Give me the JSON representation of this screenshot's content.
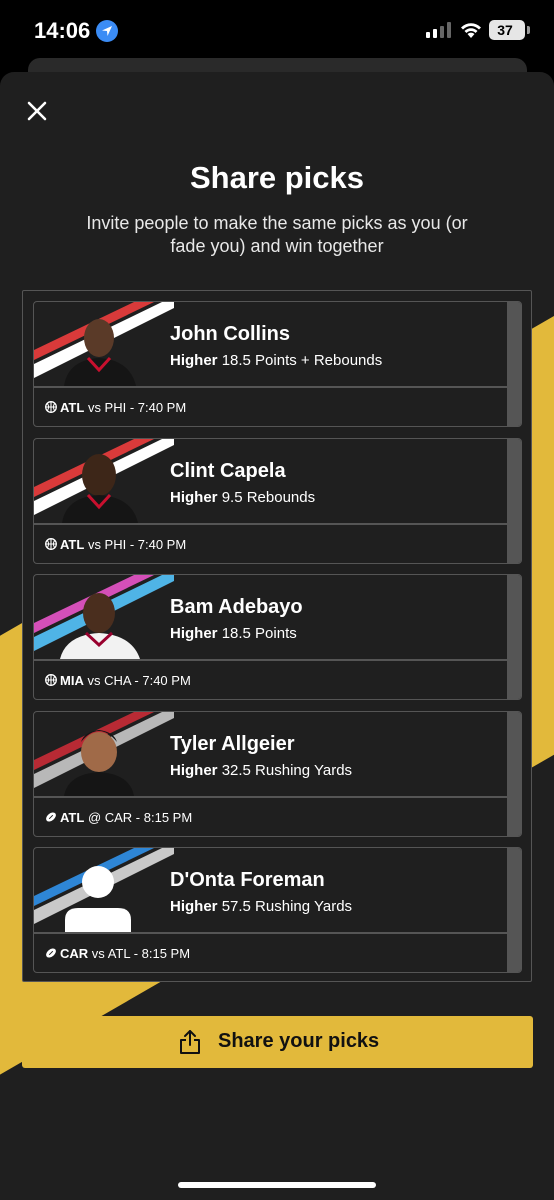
{
  "status_bar": {
    "time": "14:06",
    "battery": "37"
  },
  "sheet": {
    "title": "Share picks",
    "subtitle": "Invite people to make the same picks as you (or fade you) and win together"
  },
  "picks": [
    {
      "name": "John Collins",
      "direction": "Higher",
      "line": "18.5 Points + Rebounds",
      "team": "ATL",
      "matchup": "vs PHI - 7:40 PM",
      "sport_icon": "basketball-icon",
      "colors": [
        "#d93a3a",
        "#ffffff"
      ]
    },
    {
      "name": "Clint Capela",
      "direction": "Higher",
      "line": "9.5 Rebounds",
      "team": "ATL",
      "matchup": "vs PHI - 7:40 PM",
      "sport_icon": "basketball-icon",
      "colors": [
        "#d93a3a",
        "#ffffff"
      ]
    },
    {
      "name": "Bam Adebayo",
      "direction": "Higher",
      "line": "18.5 Points",
      "team": "MIA",
      "matchup": "vs CHA - 7:40 PM",
      "sport_icon": "basketball-icon",
      "colors": [
        "#d44fb8",
        "#4fb4e6"
      ]
    },
    {
      "name": "Tyler Allgeier",
      "direction": "Higher",
      "line": "32.5 Rushing Yards",
      "team": "ATL",
      "matchup": "@ CAR - 8:15 PM",
      "sport_icon": "football-icon",
      "colors": [
        "#b82a34",
        "#b8b8b8"
      ]
    },
    {
      "name": "D'Onta Foreman",
      "direction": "Higher",
      "line": "57.5 Rushing Yards",
      "team": "CAR",
      "matchup": "vs ATL - 8:15 PM",
      "sport_icon": "football-icon",
      "colors": [
        "#2e86d6",
        "#c9c9c9"
      ]
    }
  ],
  "share_button": {
    "label": "Share your picks",
    "icon": "share-icon"
  },
  "theme": {
    "accent": "#e2b93b",
    "background": "#1f1f1f",
    "border": "#555555"
  }
}
